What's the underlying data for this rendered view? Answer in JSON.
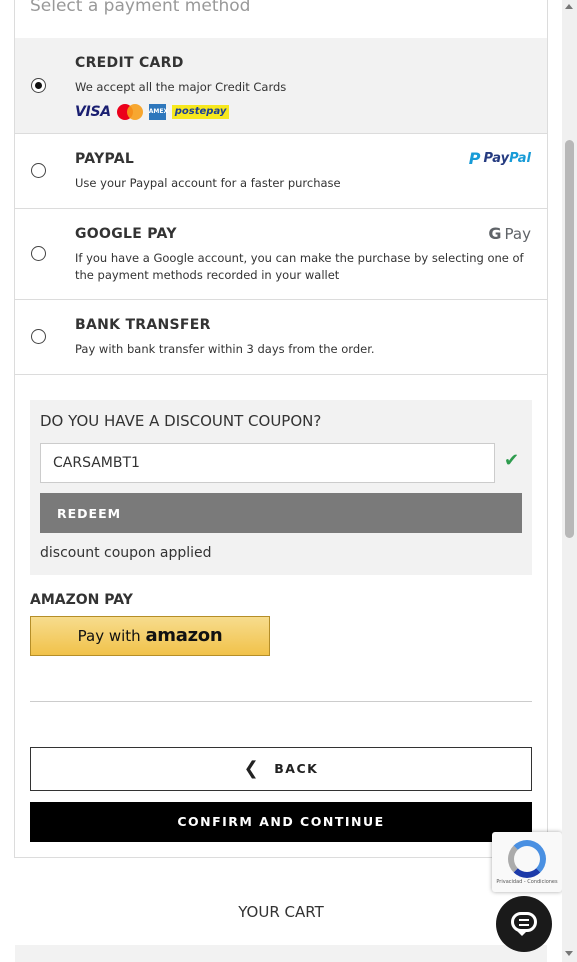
{
  "section": {
    "title": "Select a payment method"
  },
  "payment_methods": [
    {
      "name": "CREDIT CARD",
      "description": "We accept all the major Credit Cards",
      "selected": true,
      "logos": [
        "VISA",
        "mastercard-logo",
        "AMERICAN EXPRESS",
        "postepay"
      ]
    },
    {
      "name": "PAYPAL",
      "description": "Use your Paypal account for a faster purchase",
      "selected": false,
      "logo": {
        "mark": "P",
        "pay": "Pay",
        "pal": "Pal"
      }
    },
    {
      "name": "GOOGLE PAY",
      "description": "If you have a Google account, you can make the purchase by selecting one of the payment methods recorded in your wallet",
      "selected": false,
      "logo": {
        "g": "G",
        "pay": "Pay"
      }
    },
    {
      "name": "BANK TRANSFER",
      "description": "Pay with bank transfer within 3 days from the order.",
      "selected": false
    }
  ],
  "coupon": {
    "title": "DO YOU HAVE A DISCOUNT COUPON?",
    "value": "CARSAMBT1",
    "redeem_label": "REDEEM",
    "status": "discount coupon applied",
    "check_icon": "✔",
    "check_color": "#2e9c4e"
  },
  "amazon": {
    "title": "AMAZON PAY",
    "button_prefix": "Pay with",
    "button_brand": "amazon"
  },
  "actions": {
    "back_icon": "❮",
    "back_label": "BACK",
    "confirm_label": "CONFIRM AND CONTINUE"
  },
  "recaptcha": {
    "text": "Privacidad - Condiciones"
  },
  "cart": {
    "title": "YOUR CART"
  },
  "colors": {
    "selected_bg": "#f2f2f2",
    "confirm_bg": "#000000",
    "redeem_bg": "#7a7a7a"
  }
}
